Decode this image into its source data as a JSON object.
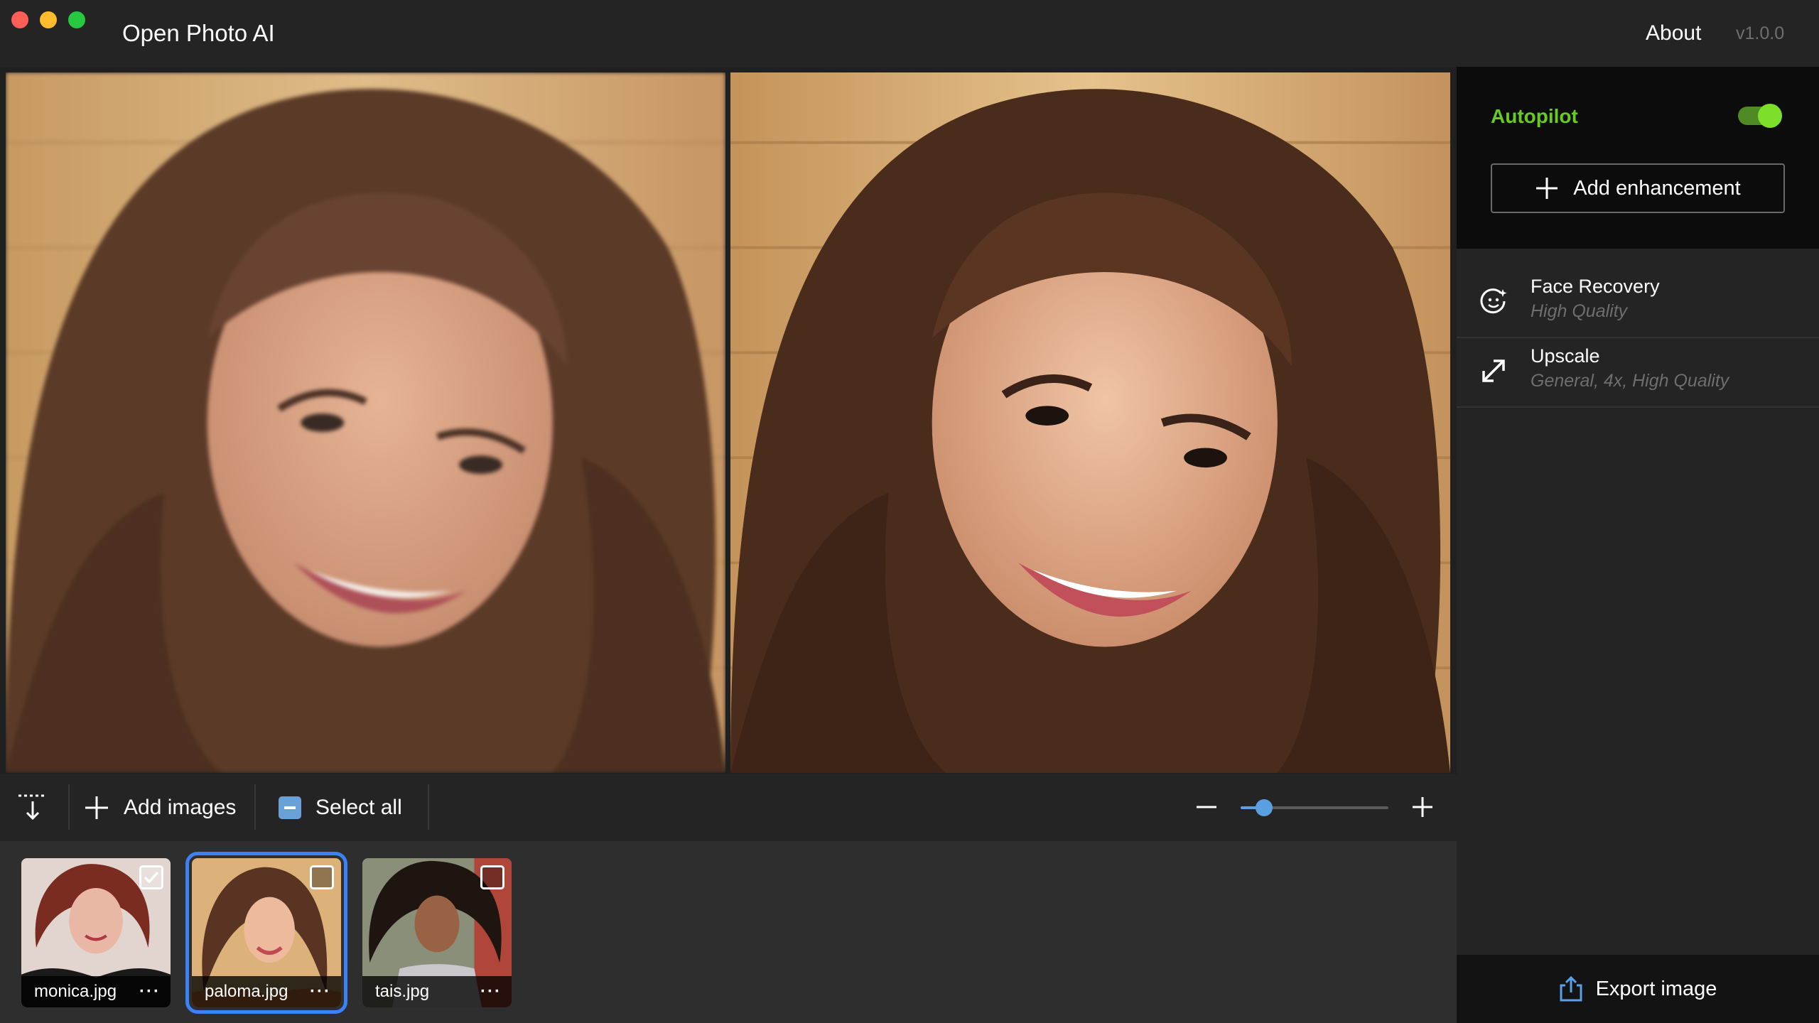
{
  "app": {
    "title": "Open Photo AI",
    "about_label": "About",
    "version": "v1.0.0"
  },
  "toolbar": {
    "add_images_label": "Add images",
    "select_all_label": "Select all",
    "zoom_level": 0.16
  },
  "thumbnails": [
    {
      "name": "monica.jpg",
      "more": "···",
      "checked": true,
      "active": false
    },
    {
      "name": "paloma.jpg",
      "more": "···",
      "checked": false,
      "active": true
    },
    {
      "name": "tais.jpg",
      "more": "···",
      "checked": false,
      "active": false
    }
  ],
  "panel": {
    "autopilot_label": "Autopilot",
    "autopilot_on": true,
    "add_enhancement_label": "Add enhancement",
    "enhancements": [
      {
        "title": "Face Recovery",
        "subtitle": "High Quality",
        "icon": "face-recovery-icon"
      },
      {
        "title": "Upscale",
        "subtitle": "General, 4x, High Quality",
        "icon": "upscale-icon"
      }
    ],
    "export_label": "Export image"
  },
  "colors": {
    "accent_green": "#66cc22",
    "accent_blue": "#3b82f6",
    "background": "#1e1e1e"
  }
}
